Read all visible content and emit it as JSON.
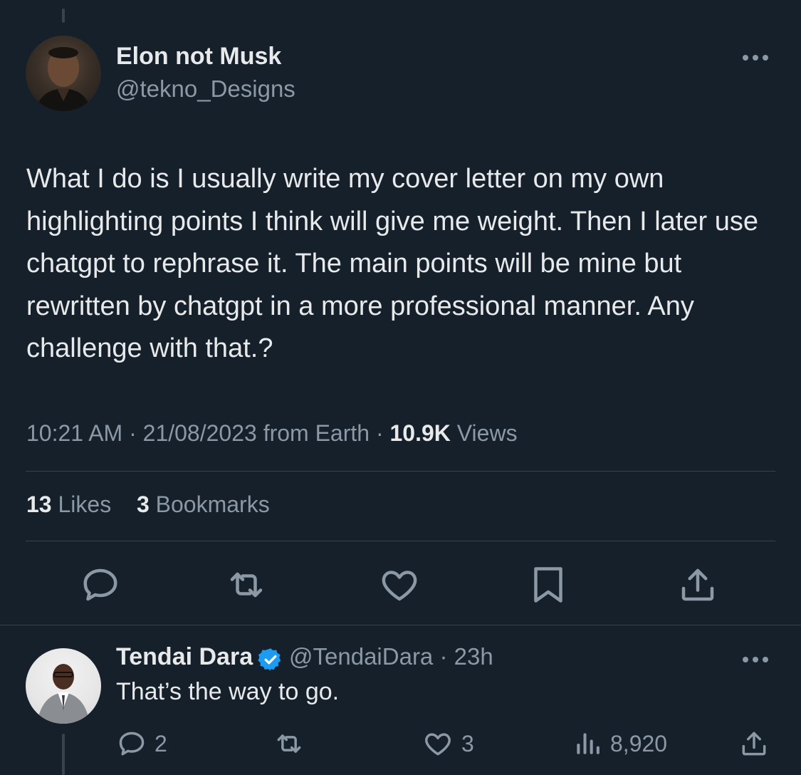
{
  "tweet": {
    "author_name": "Elon not Musk",
    "author_handle": "@tekno_Designs",
    "text": "What I do is I usually write my cover letter on my own highlighting points I think will give me weight. Then I later use chatgpt to rephrase it. The main points will be mine but rewritten by chatgpt in a more professional manner. Any challenge with that.?",
    "time": "10:21 AM",
    "date": "21/08/2023",
    "source": "from Earth",
    "views_count": "10.9K",
    "views_label": "Views",
    "likes_count": "13",
    "likes_label": "Likes",
    "bookmarks_count": "3",
    "bookmarks_label": "Bookmarks",
    "actions": [
      "reply-icon",
      "retweet-icon",
      "like-icon",
      "bookmark-icon",
      "share-icon"
    ]
  },
  "reply": {
    "author_name": "Tendai Dara",
    "author_handle": "@TendaiDara",
    "time_ago": "23h",
    "text": "That’s the way to go.",
    "reply_count": "2",
    "retweet_count": "",
    "like_count": "3",
    "view_count": "8,920"
  },
  "colors": {
    "background": "#15202b",
    "text": "#e7e9ea",
    "secondary": "#8b98a5",
    "divider": "#38444d",
    "verified": "#1d9bf0"
  }
}
